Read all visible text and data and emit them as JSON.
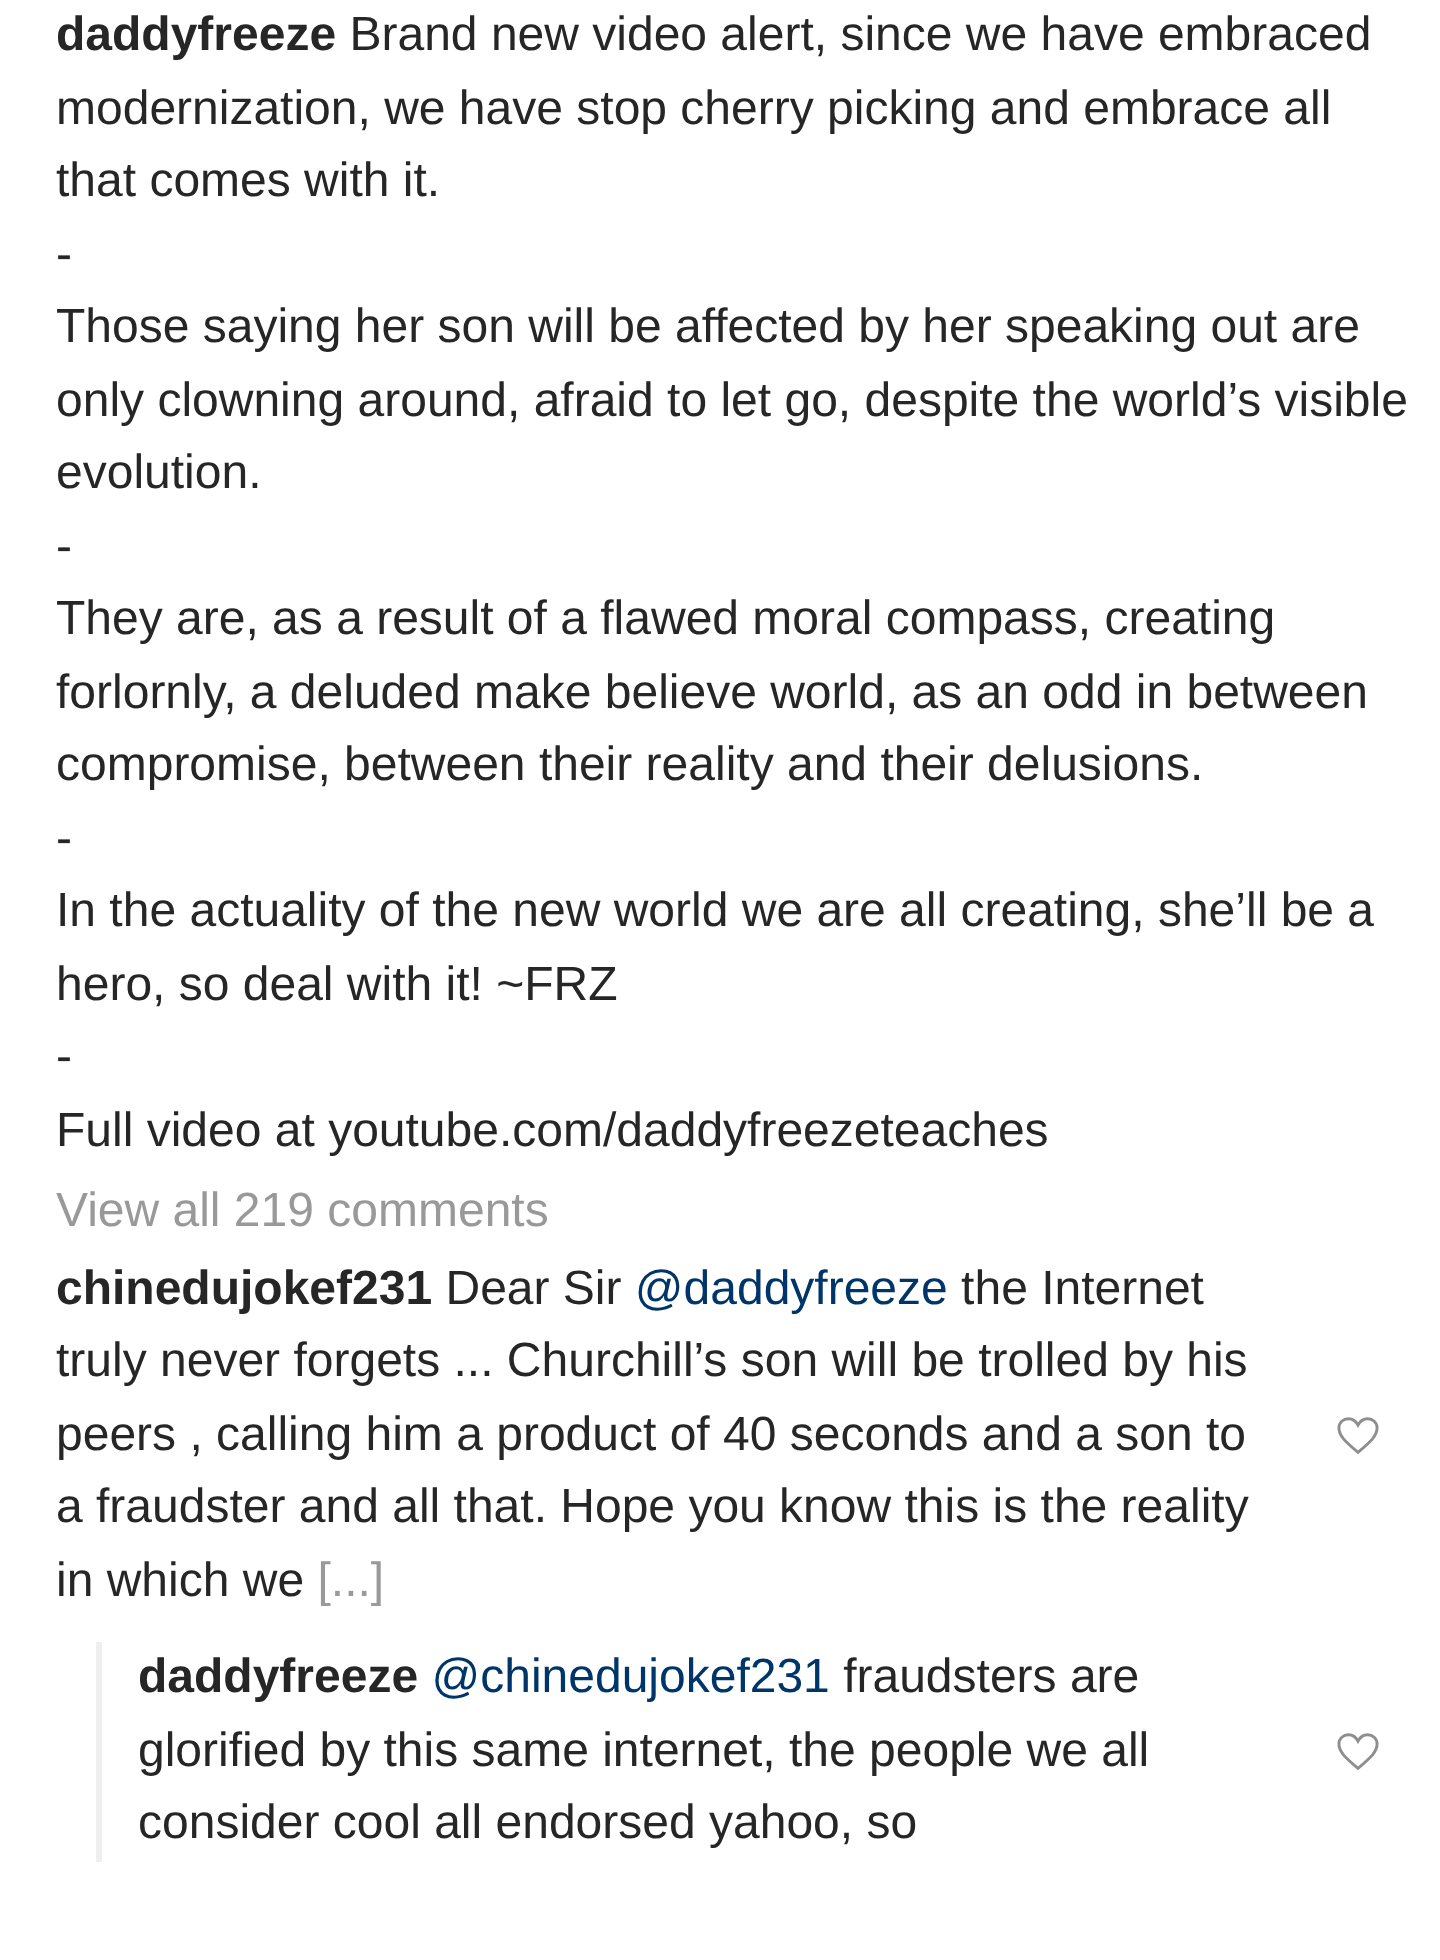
{
  "caption": {
    "username": "daddyfreeze",
    "paragraphs": [
      "Brand new video alert, since we have embraced modernization, we have stop cherry picking and embrace all that comes with it.",
      "-",
      "Those saying her son will be affected by her speaking out are only clowning around, afraid to let go, despite the world’s visible evolution.",
      "-",
      "They are, as a result of a flawed moral compass, creating forlornly, a deluded make believe world, as an odd in between compromise, between their reality and their delusions.",
      "-",
      "In the actuality of the new world we are all creating, she’ll be a hero, so deal with it! ~FRZ",
      "-",
      "Full video at youtube.com/daddyfreezeteaches"
    ]
  },
  "view_all": "View all 219 comments",
  "comments": [
    {
      "username": "chinedujokef231",
      "liked": false,
      "more": "[...]",
      "segments": [
        {
          "kind": "text",
          "text": "Dear Sir "
        },
        {
          "kind": "mention",
          "text": "@daddyfreeze"
        },
        {
          "kind": "text",
          "text": "  the Internet truly never forgets ... Churchill’s son will be trolled by his peers , calling him a product of 40 seconds and a son to a fraudster and all that. Hope you know this is the reality in which we "
        }
      ],
      "replies": [
        {
          "username": "daddyfreeze",
          "liked": false,
          "segments": [
            {
              "kind": "mention",
              "text": "@chinedujokef231"
            },
            {
              "kind": "text",
              "text": " fraudsters are glorified by this same internet, the people we all consider cool all endorsed yahoo, so"
            }
          ]
        }
      ]
    }
  ]
}
